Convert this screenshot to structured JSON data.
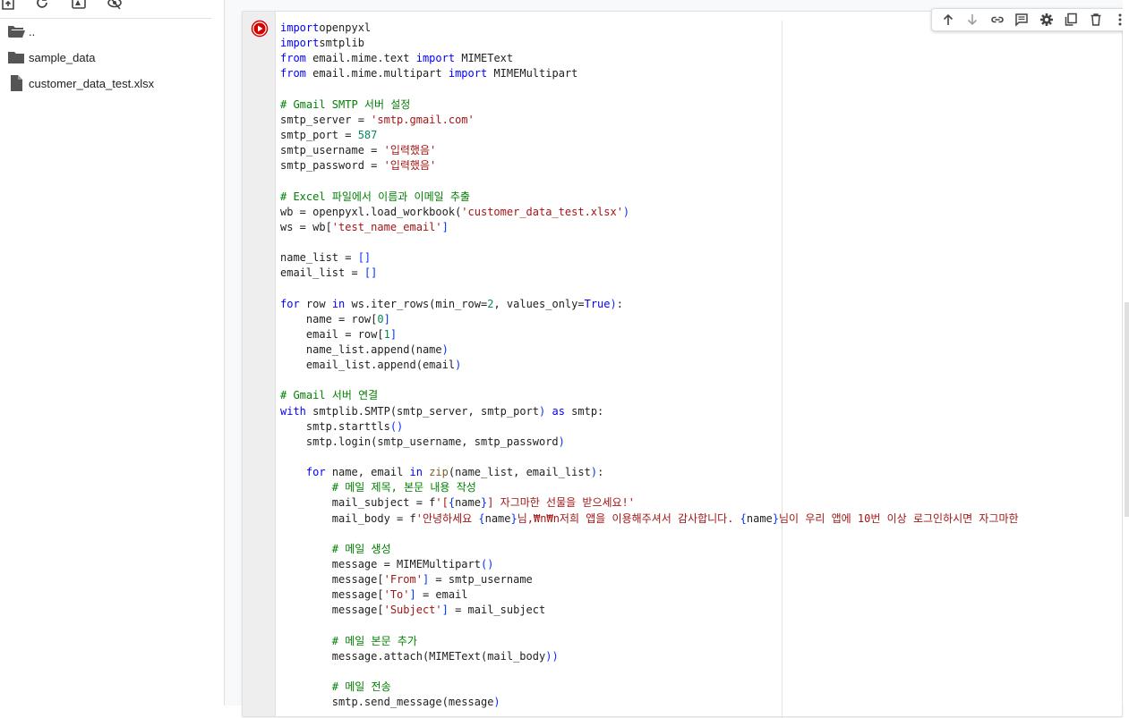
{
  "sidebar": {
    "files": [
      {
        "name": "..",
        "icon": "folder-open-icon"
      },
      {
        "name": "sample_data",
        "icon": "folder-icon"
      },
      {
        "name": "customer_data_test.xlsx",
        "icon": "file-icon"
      }
    ]
  },
  "cell": {
    "lines": [
      [
        [
          "kw",
          "import"
        ],
        [
          "",
          "openpyxl"
        ]
      ],
      [
        [
          "kw",
          "import"
        ],
        [
          "",
          "smtplib"
        ]
      ],
      [
        [
          "kw",
          "from"
        ],
        [
          "",
          " email.mime.text "
        ],
        [
          "kw",
          "import"
        ],
        [
          "",
          " MIMEText"
        ]
      ],
      [
        [
          "kw",
          "from"
        ],
        [
          "",
          " email.mime.multipart "
        ],
        [
          "kw",
          "import"
        ],
        [
          "",
          " MIMEMultipart"
        ]
      ],
      [],
      [
        [
          "com",
          "# Gmail SMTP 서버 설정"
        ]
      ],
      [
        [
          "",
          "smtp_server = "
        ],
        [
          "str",
          "'smtp.gmail.com'"
        ]
      ],
      [
        [
          "",
          "smtp_port = "
        ],
        [
          "num",
          "587"
        ]
      ],
      [
        [
          "",
          "smtp_username = "
        ],
        [
          "str",
          "'입력했음'"
        ]
      ],
      [
        [
          "",
          "smtp_password = "
        ],
        [
          "str",
          "'입력했음'"
        ]
      ],
      [],
      [
        [
          "com",
          "# Excel 파일에서 이름과 이메일 추출"
        ]
      ],
      [
        [
          "",
          "wb = openpyxl.load_workbook("
        ],
        [
          "str",
          "'customer_data_test.xlsx'"
        ],
        [
          "p",
          ")"
        ]
      ],
      [
        [
          "",
          "ws = wb["
        ],
        [
          "str",
          "'test_name_email'"
        ],
        [
          "p",
          "]"
        ]
      ],
      [],
      [
        [
          "",
          "name_list = "
        ],
        [
          "p",
          "[]"
        ]
      ],
      [
        [
          "",
          "email_list = "
        ],
        [
          "p",
          "[]"
        ]
      ],
      [],
      [
        [
          "kw",
          "for"
        ],
        [
          "",
          " row "
        ],
        [
          "kw",
          "in"
        ],
        [
          "",
          " ws.iter_rows(min_row="
        ],
        [
          "num",
          "2"
        ],
        [
          "",
          ", values_only="
        ],
        [
          "kw",
          "True"
        ],
        [
          "p",
          ")"
        ],
        [
          "",
          ":"
        ]
      ],
      [
        [
          "",
          "    name = row["
        ],
        [
          "num",
          "0"
        ],
        [
          "p",
          "]"
        ]
      ],
      [
        [
          "",
          "    email = row["
        ],
        [
          "num",
          "1"
        ],
        [
          "p",
          "]"
        ]
      ],
      [
        [
          "",
          "    name_list.append(name"
        ],
        [
          "p",
          ")"
        ]
      ],
      [
        [
          "",
          "    email_list.append(email"
        ],
        [
          "p",
          ")"
        ]
      ],
      [],
      [
        [
          "com",
          "# Gmail 서버 연결"
        ]
      ],
      [
        [
          "kw",
          "with"
        ],
        [
          "",
          " smtplib.SMTP(smtp_server, smtp_port"
        ],
        [
          "p",
          ")"
        ],
        [
          "",
          " "
        ],
        [
          "kw",
          "as"
        ],
        [
          "",
          " smtp:"
        ]
      ],
      [
        [
          "",
          "    smtp.starttls"
        ],
        [
          "p",
          "()"
        ]
      ],
      [
        [
          "",
          "    smtp.login(smtp_username, smtp_password"
        ],
        [
          "p",
          ")"
        ]
      ],
      [],
      [
        [
          "",
          "    "
        ],
        [
          "kw",
          "for"
        ],
        [
          "",
          " name, email "
        ],
        [
          "kw",
          "in"
        ],
        [
          "",
          " "
        ],
        [
          "fn",
          "zip"
        ],
        [
          "",
          "(name_list, email_list"
        ],
        [
          "p",
          ")"
        ],
        [
          "",
          ":"
        ]
      ],
      [
        [
          "",
          "        "
        ],
        [
          "com",
          "# 메일 제목, 본문 내용 작성"
        ]
      ],
      [
        [
          "",
          "        mail_subject = f"
        ],
        [
          "str",
          "'["
        ],
        [
          "p",
          "{"
        ],
        [
          "",
          "name"
        ],
        [
          "p",
          "}"
        ],
        [
          "str",
          "] 자그마한 선물을 받으세요!'"
        ]
      ],
      [
        [
          "",
          "        mail_body = f"
        ],
        [
          "str",
          "'안녕하세요 "
        ],
        [
          "p",
          "{"
        ],
        [
          "",
          "name"
        ],
        [
          "p",
          "}"
        ],
        [
          "str",
          "님,₩n₩n저희 앱을 이용해주셔서 감사합니다. "
        ],
        [
          "p",
          "{"
        ],
        [
          "",
          "name"
        ],
        [
          "p",
          "}"
        ],
        [
          "str",
          "님이 우리 앱에 10번 이상 로그인하시면 자그마한"
        ]
      ],
      [],
      [
        [
          "",
          "        "
        ],
        [
          "com",
          "# 메일 생성"
        ]
      ],
      [
        [
          "",
          "        message = MIMEMultipart"
        ],
        [
          "p",
          "()"
        ]
      ],
      [
        [
          "",
          "        message["
        ],
        [
          "str",
          "'From'"
        ],
        [
          "p",
          "]"
        ],
        [
          "",
          " = smtp_username"
        ]
      ],
      [
        [
          "",
          "        message["
        ],
        [
          "str",
          "'To'"
        ],
        [
          "p",
          "]"
        ],
        [
          "",
          " = email"
        ]
      ],
      [
        [
          "",
          "        message["
        ],
        [
          "str",
          "'Subject'"
        ],
        [
          "p",
          "]"
        ],
        [
          "",
          " = mail_subject"
        ]
      ],
      [],
      [
        [
          "",
          "        "
        ],
        [
          "com",
          "# 메일 본문 추가"
        ]
      ],
      [
        [
          "",
          "        message.attach(MIMEText(mail_body"
        ],
        [
          "p",
          "))"
        ]
      ],
      [],
      [
        [
          "",
          "        "
        ],
        [
          "com",
          "# 메일 전송"
        ]
      ],
      [
        [
          "",
          "        smtp.send_message(message"
        ],
        [
          "p",
          ")"
        ]
      ]
    ]
  },
  "colors": {
    "keyword": "#0000ff",
    "string": "#a31515",
    "number": "#098658",
    "comment": "#008000",
    "run_button": "#d50000"
  }
}
